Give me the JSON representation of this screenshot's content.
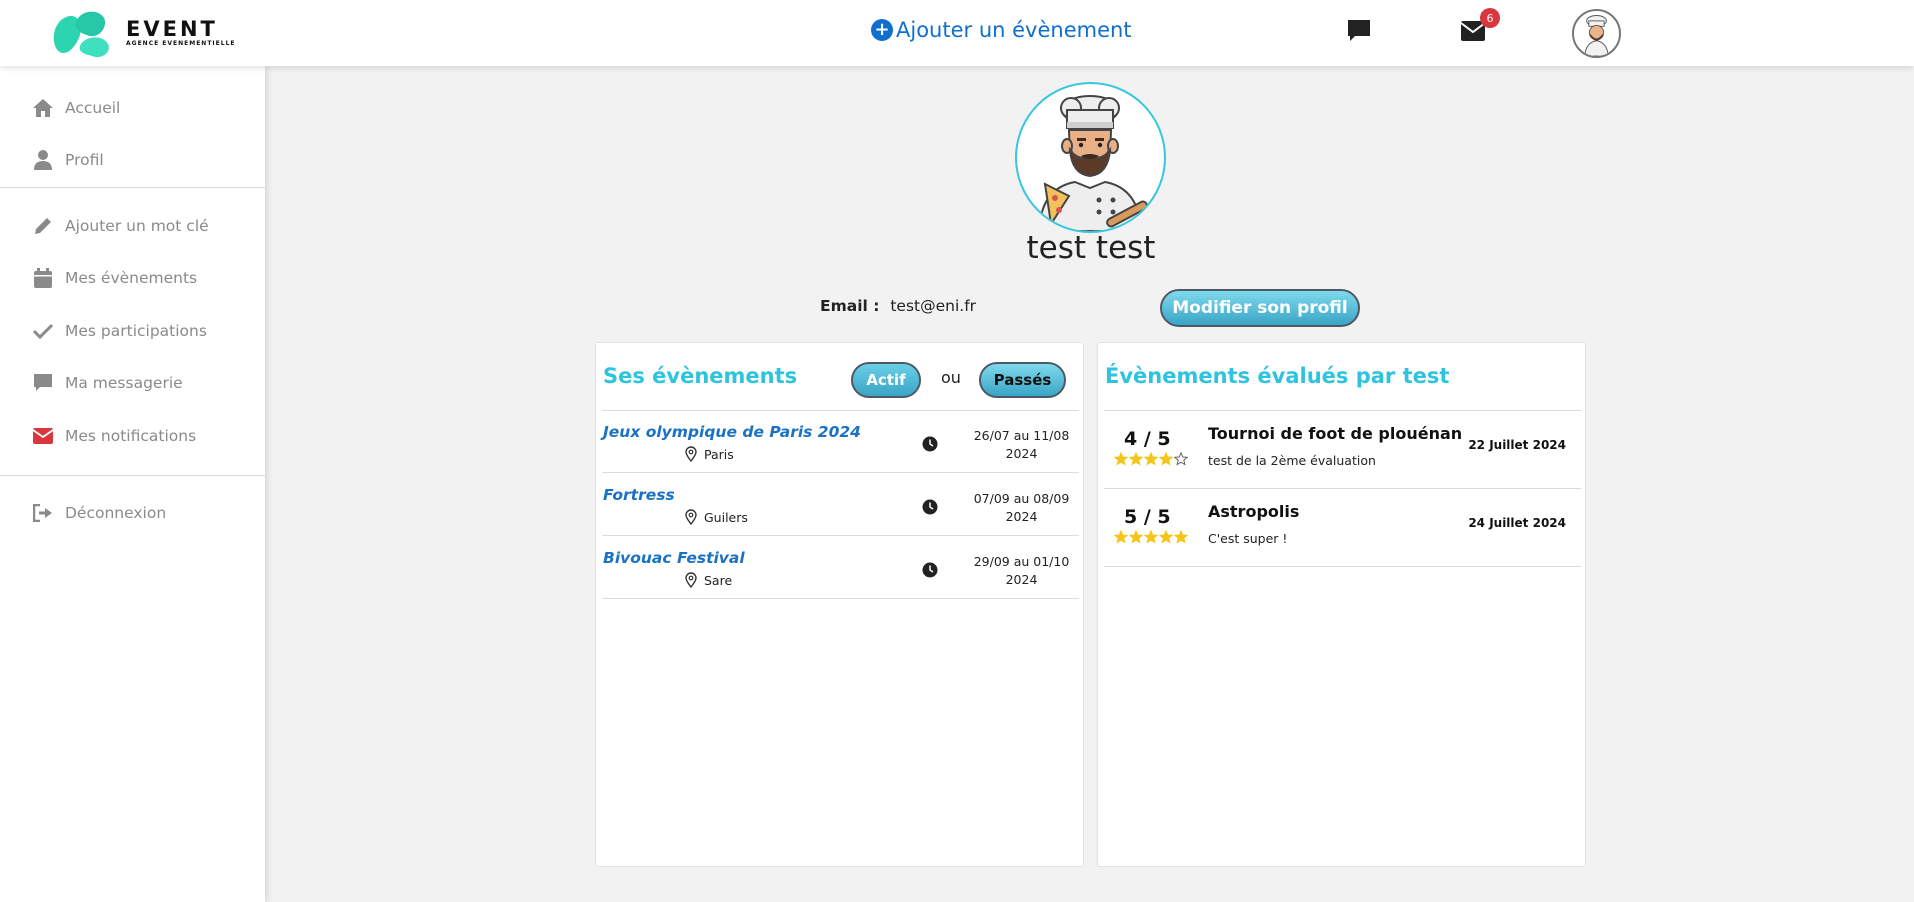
{
  "header": {
    "logo": {
      "title": "EVENT",
      "subtitle": "AGENCE EVENEMENTIELLE"
    },
    "add_event_label": "Ajouter un évènement",
    "notifications_count": "6",
    "icons": {
      "chat": "chat-icon",
      "mail": "envelope-icon",
      "avatar": "user-avatar"
    }
  },
  "sidebar": {
    "items": [
      {
        "label": "Accueil",
        "icon": "home-icon"
      },
      {
        "label": "Profil",
        "icon": "user-icon"
      },
      {
        "label": "Ajouter un mot clé",
        "icon": "pencil-icon"
      },
      {
        "label": "Mes évènements",
        "icon": "calendar-icon"
      },
      {
        "label": "Mes participations",
        "icon": "check-icon"
      },
      {
        "label": "Ma messagerie",
        "icon": "chat-icon"
      },
      {
        "label": "Mes notifications",
        "icon": "envelope-icon"
      },
      {
        "label": "Déconnexion",
        "icon": "logout-icon"
      }
    ]
  },
  "profile": {
    "name": "test test",
    "email_label": "Email :",
    "email": "test@eni.fr",
    "edit_button": "Modifier son profil"
  },
  "events_panel": {
    "title": "Ses évènements",
    "filter_active": "Actif",
    "filter_or": "ou",
    "filter_past": "Passés",
    "events": [
      {
        "title": "Jeux olympique de Paris 2024",
        "location": "Paris",
        "dates_line1": "26/07 au 11/08",
        "dates_line2": "2024"
      },
      {
        "title": "Fortress",
        "location": "Guilers",
        "dates_line1": "07/09 au 08/09",
        "dates_line2": "2024"
      },
      {
        "title": "Bivouac Festival",
        "location": "Sare",
        "dates_line1": "29/09 au 01/10",
        "dates_line2": "2024"
      }
    ]
  },
  "rated_panel": {
    "title": "Évènements évalués par test",
    "items": [
      {
        "score": "4 / 5",
        "rating": 4,
        "title": "Tournoi de foot de plouénan",
        "comment": "test de la 2ème évaluation",
        "date": "22 Juillet 2024"
      },
      {
        "score": "5 / 5",
        "rating": 5,
        "title": "Astropolis",
        "comment": "C'est super !",
        "date": "24 Juillet 2024"
      }
    ]
  },
  "colors": {
    "accent": "#2ec3de",
    "link": "#1b72c4",
    "brand_blue": "#0f6fd1",
    "star": "#f5c518",
    "notification": "#d9363e"
  }
}
